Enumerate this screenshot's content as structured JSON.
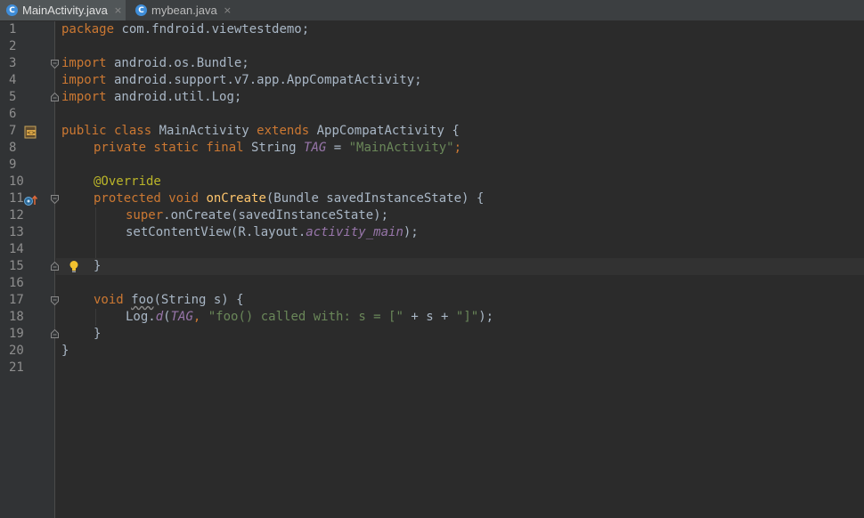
{
  "tabs": [
    {
      "label": "MainActivity.java",
      "icon": "C",
      "active": true
    },
    {
      "label": "mybean.java",
      "icon": "C",
      "active": false
    }
  ],
  "tab_close": "×",
  "line_numbers": [
    "1",
    "2",
    "3",
    "4",
    "5",
    "6",
    "7",
    "8",
    "9",
    "10",
    "11",
    "12",
    "13",
    "14",
    "15",
    "16",
    "17",
    "18",
    "19",
    "20",
    "21"
  ],
  "code": {
    "l1": {
      "kw": "package",
      "rest": " com.fndroid.viewtestdemo;"
    },
    "l3": {
      "kw": "import",
      "rest": " android.os.Bundle;"
    },
    "l4": {
      "kw": "import",
      "rest": " android.support.v7.app.AppCompatActivity;"
    },
    "l5": {
      "kw": "import",
      "rest": " android.util.Log;"
    },
    "l7": {
      "kw1": "public class",
      "name": " MainActivity ",
      "kw2": "extends",
      "rest": " AppCompatActivity {"
    },
    "l8": {
      "kw": "private static final",
      "type": " String ",
      "const": "TAG",
      "eq": " = ",
      "str": "\"MainActivity\"",
      "semi": ";"
    },
    "l10": {
      "ann": "@Override"
    },
    "l11": {
      "kw": "protected void",
      "fn": " onCreate",
      "rest": "(Bundle savedInstanceState) {"
    },
    "l12": {
      "kw": "super",
      "rest": ".onCreate(savedInstanceState);"
    },
    "l13": {
      "pre": "setContentView(R.layout.",
      "static": "activity_main",
      "post": ");"
    },
    "l15": {
      "brace": "}"
    },
    "l17": {
      "kw": "void",
      "sp": " ",
      "fn": "foo",
      "rest": "(String s) {"
    },
    "l18": {
      "pre": "Log.",
      "m": "d",
      "p1": "(",
      "const": "TAG",
      "p2": ", ",
      "str1": "\"foo() called with: s = [\"",
      "mid": " + s + ",
      "str2": "\"]\"",
      "end": ");"
    },
    "l19": {
      "brace": "}"
    },
    "l20": {
      "brace": "}"
    }
  },
  "colors": {
    "keyword": "#cc7832",
    "string": "#6a8759",
    "annotation": "#bbb529",
    "method": "#ffc66d",
    "static_field": "#9876aa",
    "text": "#a9b7c6",
    "background": "#2b2b2b"
  },
  "gutter_icons": {
    "line7": "class-file-icon",
    "line11": "override-method-icon",
    "line15": "lightbulb-icon"
  }
}
